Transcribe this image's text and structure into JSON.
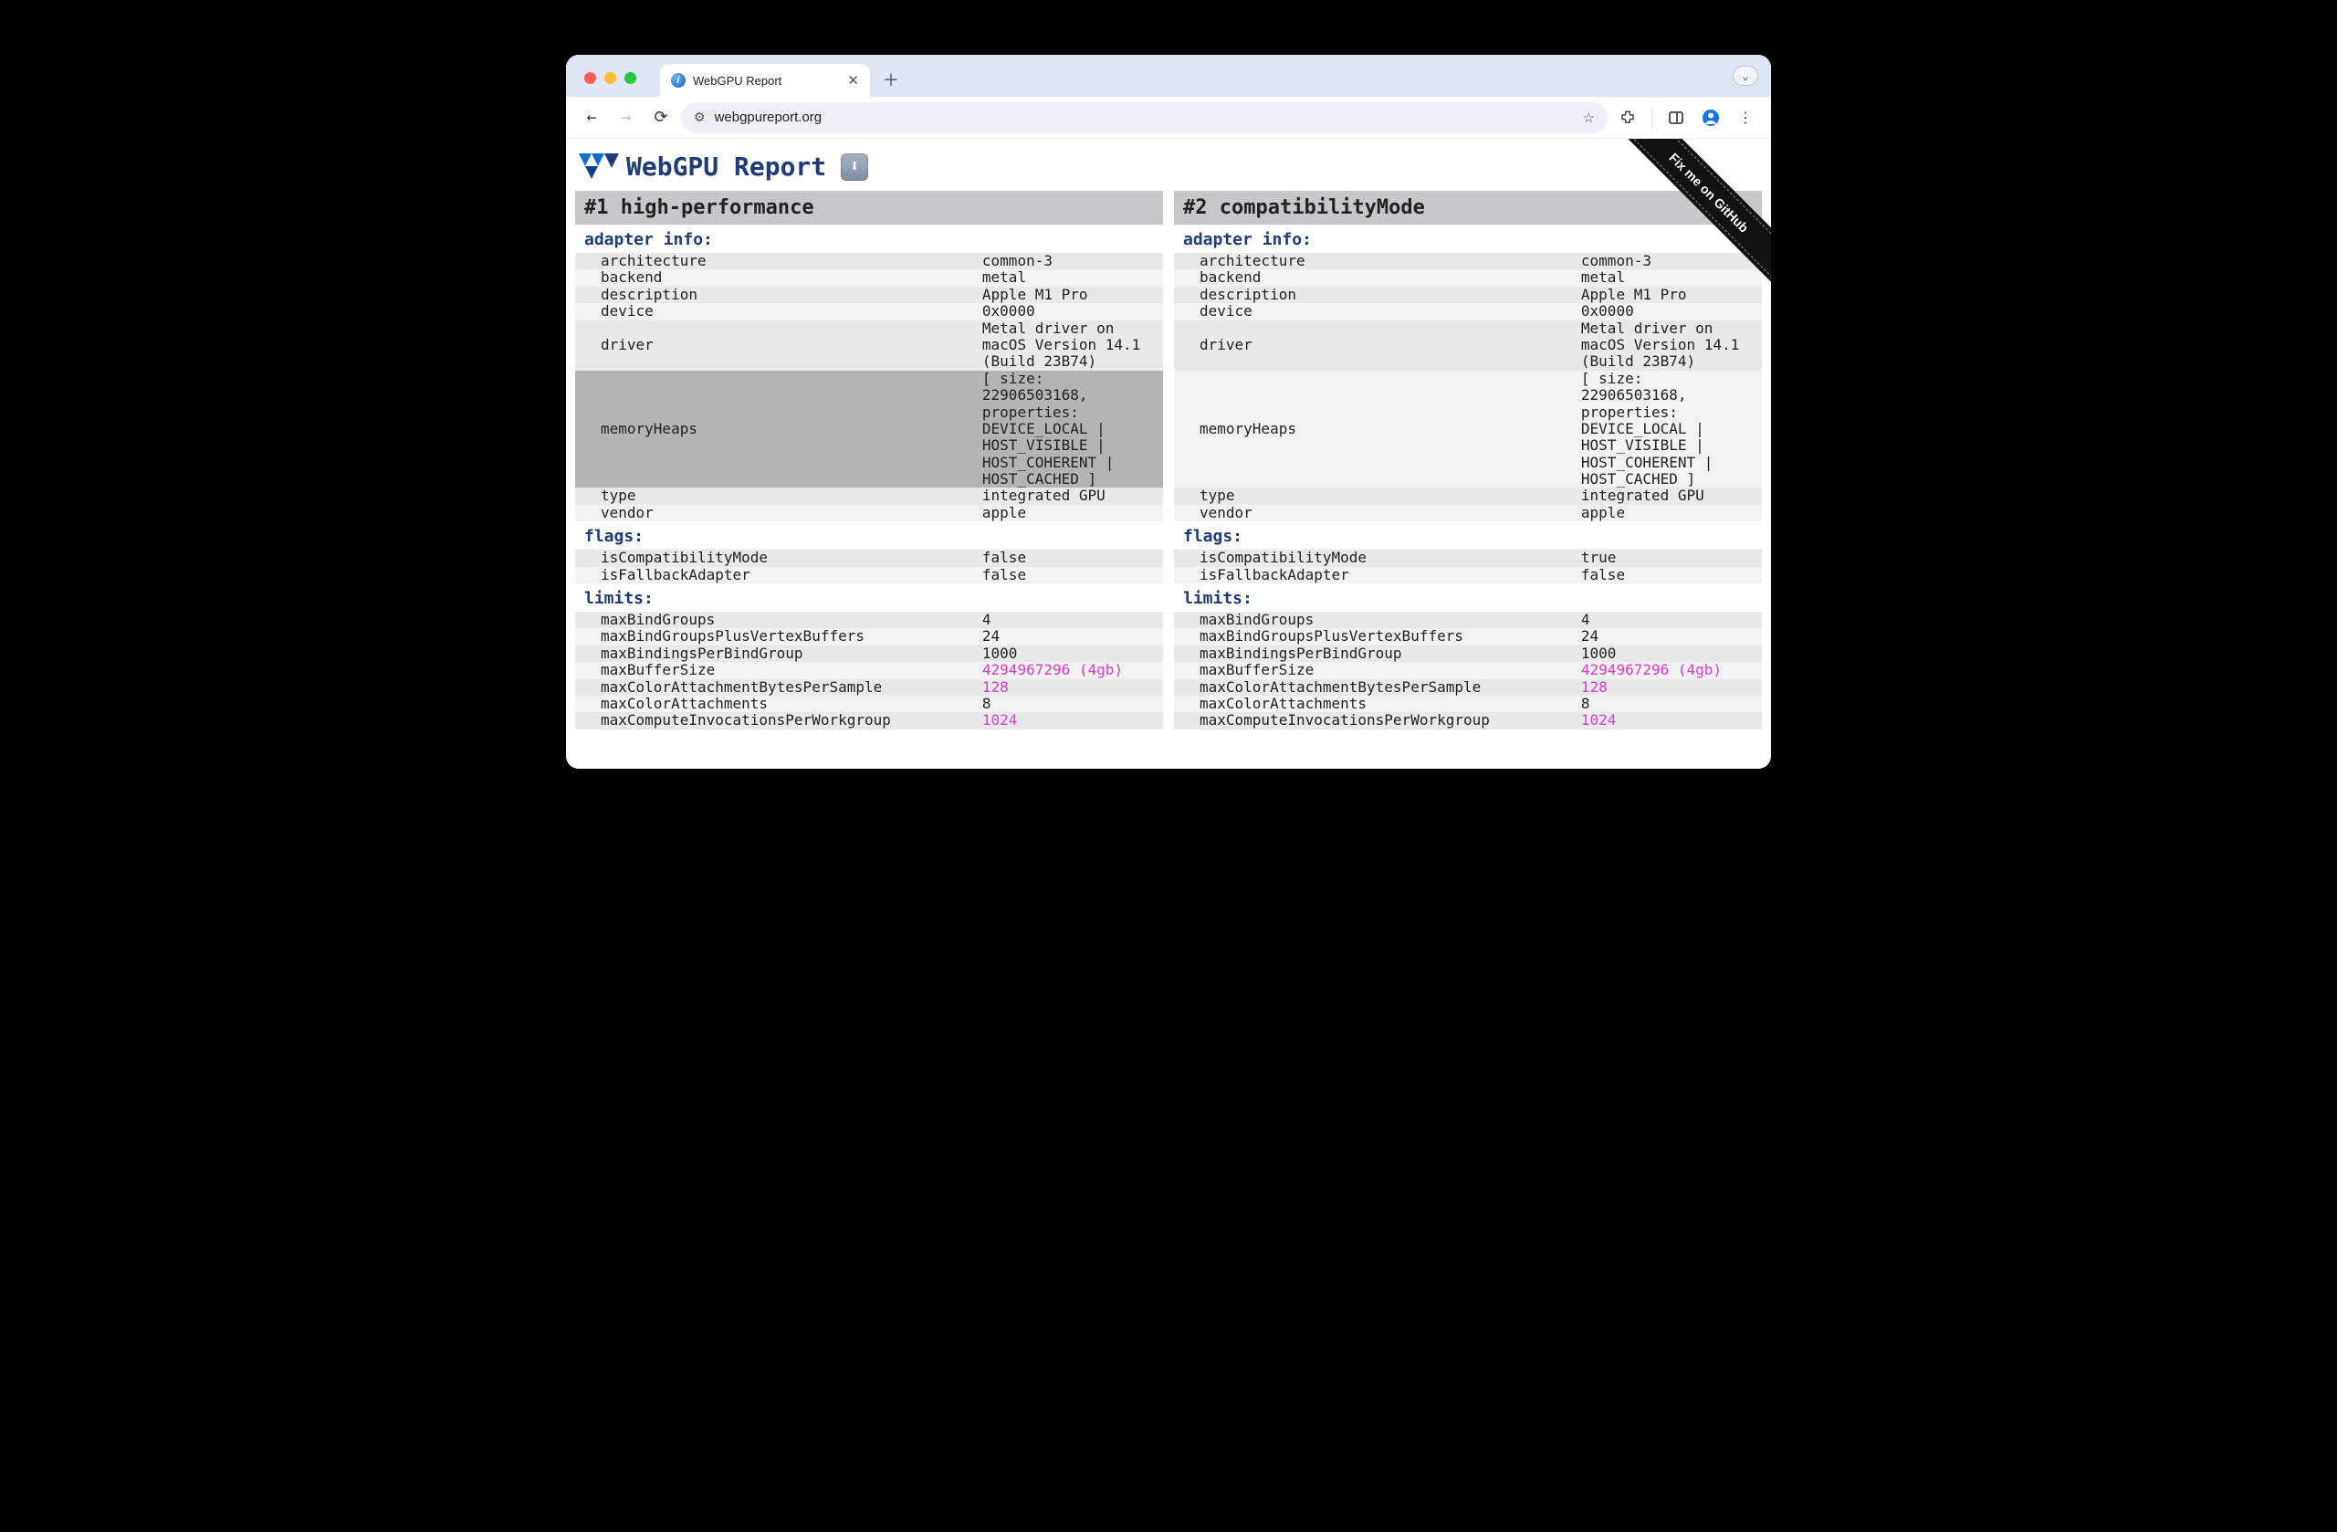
{
  "browser": {
    "tab_title": "WebGPU Report",
    "url": "webgpureport.org"
  },
  "page_title": "WebGPU Report",
  "ribbon": "Fix me on GitHub",
  "columns": [
    {
      "title": "#1 high-performance",
      "sections": [
        {
          "heading": "adapter info:",
          "rows": [
            {
              "k": "architecture",
              "v": "common-3"
            },
            {
              "k": "backend",
              "v": "metal"
            },
            {
              "k": "description",
              "v": "Apple M1 Pro"
            },
            {
              "k": "device",
              "v": "0x0000"
            },
            {
              "k": "driver",
              "v": "Metal driver on macOS Version 14.1 (Build 23B74)"
            },
            {
              "k": "memoryHeaps",
              "v": "[ size: 22906503168, properties: DEVICE_LOCAL | HOST_VISIBLE | HOST_COHERENT | HOST_CACHED ]",
              "hl": true
            },
            {
              "k": "type",
              "v": "integrated GPU"
            },
            {
              "k": "vendor",
              "v": "apple"
            }
          ]
        },
        {
          "heading": "flags:",
          "rows": [
            {
              "k": "isCompatibilityMode",
              "v": "false"
            },
            {
              "k": "isFallbackAdapter",
              "v": "false"
            }
          ]
        },
        {
          "heading": "limits:",
          "rows": [
            {
              "k": "maxBindGroups",
              "v": "4"
            },
            {
              "k": "maxBindGroupsPlusVertexBuffers",
              "v": "24"
            },
            {
              "k": "maxBindingsPerBindGroup",
              "v": "1000"
            },
            {
              "k": "maxBufferSize",
              "v": "4294967296 (4gb)",
              "pink": true
            },
            {
              "k": "maxColorAttachmentBytesPerSample",
              "v": "128",
              "pink": true
            },
            {
              "k": "maxColorAttachments",
              "v": "8"
            },
            {
              "k": "maxComputeInvocationsPerWorkgroup",
              "v": "1024",
              "pink": true,
              "cut": true
            }
          ]
        }
      ]
    },
    {
      "title": "#2 compatibilityMode",
      "sections": [
        {
          "heading": "adapter info:",
          "rows": [
            {
              "k": "architecture",
              "v": "common-3"
            },
            {
              "k": "backend",
              "v": "metal"
            },
            {
              "k": "description",
              "v": "Apple M1 Pro"
            },
            {
              "k": "device",
              "v": "0x0000"
            },
            {
              "k": "driver",
              "v": "Metal driver on macOS Version 14.1 (Build 23B74)"
            },
            {
              "k": "memoryHeaps",
              "v": "[ size: 22906503168, properties: DEVICE_LOCAL | HOST_VISIBLE | HOST_COHERENT | HOST_CACHED ]"
            },
            {
              "k": "type",
              "v": "integrated GPU"
            },
            {
              "k": "vendor",
              "v": "apple"
            }
          ]
        },
        {
          "heading": "flags:",
          "rows": [
            {
              "k": "isCompatibilityMode",
              "v": "true"
            },
            {
              "k": "isFallbackAdapter",
              "v": "false"
            }
          ]
        },
        {
          "heading": "limits:",
          "rows": [
            {
              "k": "maxBindGroups",
              "v": "4"
            },
            {
              "k": "maxBindGroupsPlusVertexBuffers",
              "v": "24"
            },
            {
              "k": "maxBindingsPerBindGroup",
              "v": "1000"
            },
            {
              "k": "maxBufferSize",
              "v": "4294967296 (4gb)",
              "pink": true
            },
            {
              "k": "maxColorAttachmentBytesPerSample",
              "v": "128",
              "pink": true
            },
            {
              "k": "maxColorAttachments",
              "v": "8"
            },
            {
              "k": "maxComputeInvocationsPerWorkgroup",
              "v": "1024",
              "pink": true,
              "cut": true
            }
          ]
        }
      ]
    }
  ]
}
